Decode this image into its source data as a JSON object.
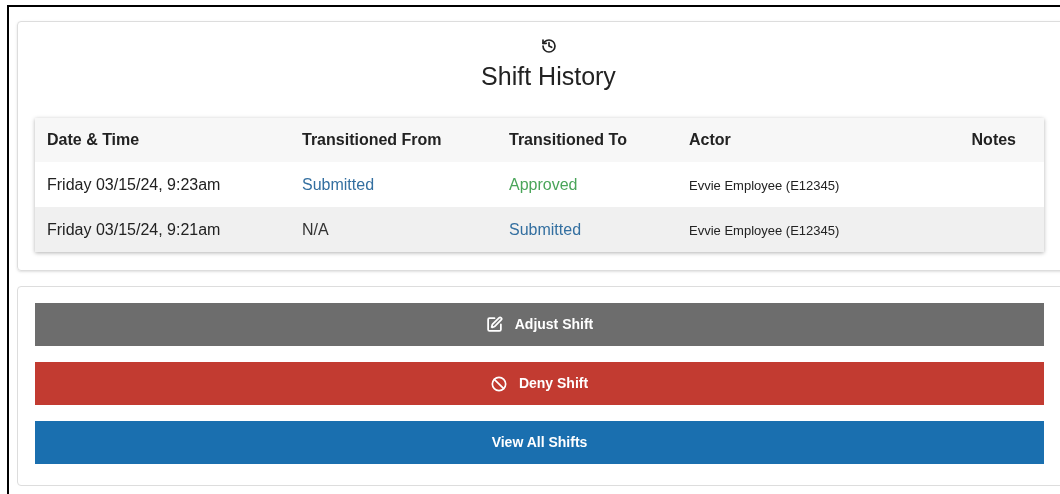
{
  "history": {
    "title": "Shift History",
    "columns": [
      "Date & Time",
      "Transitioned From",
      "Transitioned To",
      "Actor",
      "Notes"
    ],
    "rows": [
      {
        "date": "Friday 03/15/24, 9:23am",
        "from": {
          "text": "Submitted",
          "color": "#336fa0"
        },
        "to": {
          "text": "Approved",
          "color": "#4aa55a"
        },
        "actor": "Evvie Employee (E12345)"
      },
      {
        "date": "Friday 03/15/24, 9:21am",
        "from": {
          "text": "N/A",
          "color": "#333333"
        },
        "to": {
          "text": "Submitted",
          "color": "#336fa0"
        },
        "actor": "Evvie Employee (E12345)"
      }
    ]
  },
  "actions": [
    {
      "label": "Adjust Shift",
      "kind": "neutral"
    },
    {
      "label": "Deny Shift",
      "kind": "danger"
    },
    {
      "label": "View All Shifts",
      "kind": "primary"
    }
  ]
}
